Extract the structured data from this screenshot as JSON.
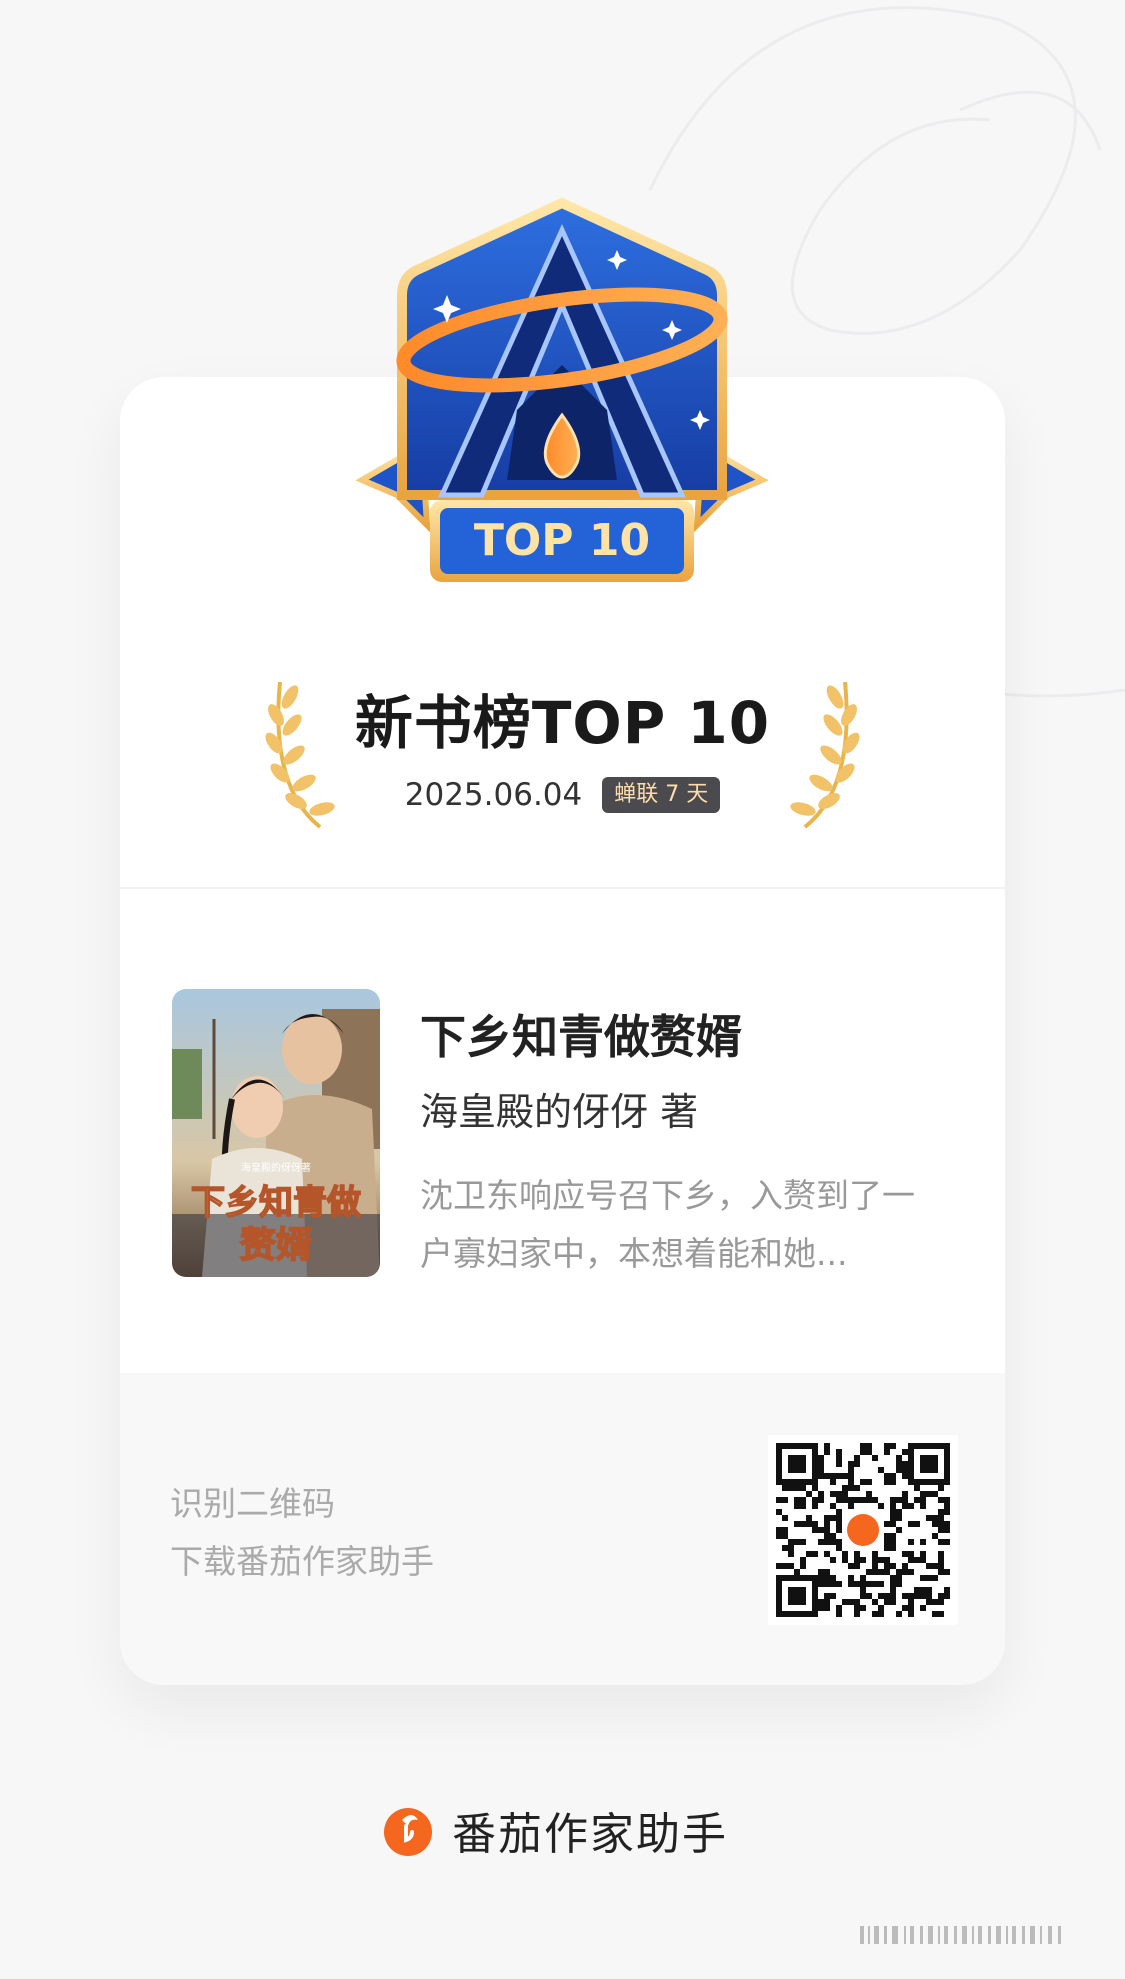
{
  "ranking": {
    "badge_text": "TOP 10",
    "title": "新书榜TOP 10",
    "date": "2025.06.04",
    "tag": "蝉联 7 天"
  },
  "book": {
    "title": "下乡知青做赘婿",
    "author": "海皇殿的伢伢 著",
    "description": "沈卫东响应号召下乡，入赘到了一户寡妇家中，本想着能和她...",
    "cover_author_text": "海皇殿的伢伢著",
    "cover_title_text": "下乡知青做赘婿"
  },
  "footer": {
    "qr_line1": "识别二维码",
    "qr_line2": "下载番茄作家助手"
  },
  "brand": {
    "name": "番茄作家助手",
    "icon": "tomato-logo-icon",
    "color": "#f5661e"
  }
}
